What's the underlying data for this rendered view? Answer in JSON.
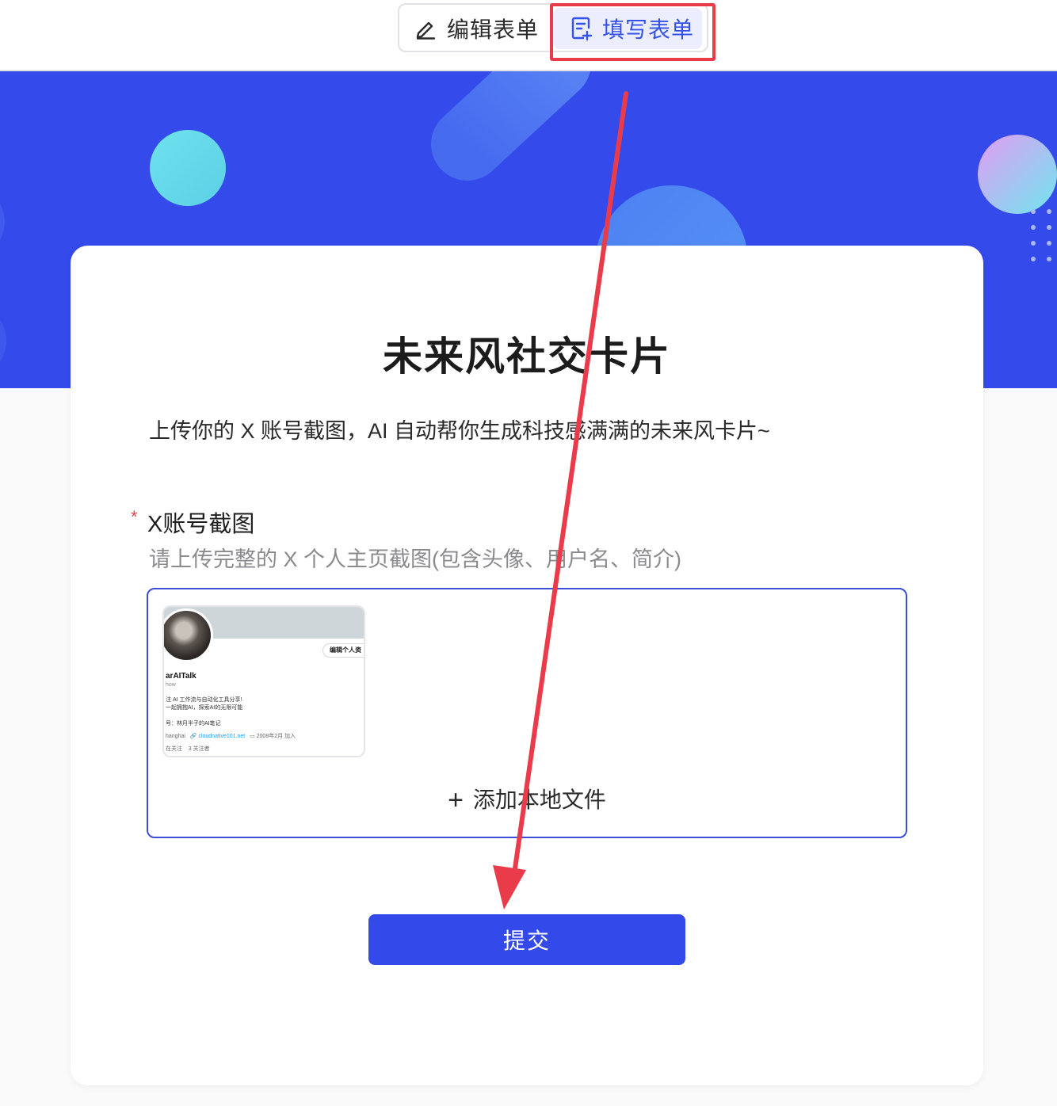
{
  "toolbar": {
    "edit_label": "编辑表单",
    "fill_label": "填写表单",
    "active_tab": "填写表单"
  },
  "form": {
    "title": "未来风社交卡片",
    "description": "上传你的 X 账号截图，AI 自动帮你生成科技感满满的未来风卡片~",
    "field": {
      "required_mark": "*",
      "label": "X账号截图",
      "hint": "请上传完整的 X 个人主页截图(包含头像、用户名、简介)"
    },
    "upload": {
      "add_label": "添加本地文件",
      "thumbnail": {
        "edit_button": "编辑个人资",
        "display_name": "arAITalk",
        "handle": "how",
        "bio_line1": "注 AI 工作流与自动化工具分享!",
        "bio_line2": "一起拥抱AI，探索AI的无限可能",
        "bio_line3": "号：林月半子的AI笔记",
        "location": "hanghai",
        "link": "cloudnative101.net",
        "joined": "2008年2月 加入",
        "following": "在关注",
        "followers": "3 关注者"
      }
    },
    "submit_label": "提交"
  },
  "colors": {
    "accent": "#3449ea",
    "banner": "#344aeb",
    "annotation": "#ea3b4a",
    "required": "#e0464e"
  },
  "icons": {
    "edit": "pencil-icon",
    "fill": "form-edit-icon",
    "add": "plus-icon"
  }
}
